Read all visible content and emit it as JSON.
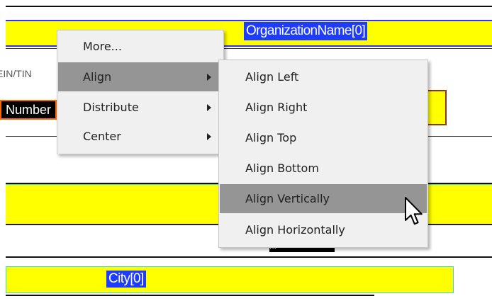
{
  "form": {
    "org_field": "OrganizationName[0]",
    "ein_label": "EIN/TIN",
    "number_field": "Number",
    "city_field": "City[0]",
    "hidden_field_fragment": "..."
  },
  "context_menu": {
    "items": [
      {
        "label": "More...",
        "has_submenu": false,
        "highlighted": false
      },
      {
        "label": "Align",
        "has_submenu": true,
        "highlighted": true
      },
      {
        "label": "Distribute",
        "has_submenu": true,
        "highlighted": false
      },
      {
        "label": "Center",
        "has_submenu": true,
        "highlighted": false
      }
    ]
  },
  "submenu": {
    "items": [
      {
        "label": "Align Left",
        "highlighted": false
      },
      {
        "label": "Align Right",
        "highlighted": false
      },
      {
        "label": "Align Top",
        "highlighted": false
      },
      {
        "label": "Align Bottom",
        "highlighted": false
      },
      {
        "label": "Align Vertically",
        "highlighted": true
      },
      {
        "label": "Align Horizontally",
        "highlighted": false
      }
    ]
  },
  "colors": {
    "field_fill": "#ffff00",
    "selection_blue": "#1e3cff",
    "menu_bg": "#f0f0f0",
    "menu_highlight": "#959595",
    "field_border_cyan": "#35d6e0"
  },
  "cursor": "arrow-pointer-icon"
}
